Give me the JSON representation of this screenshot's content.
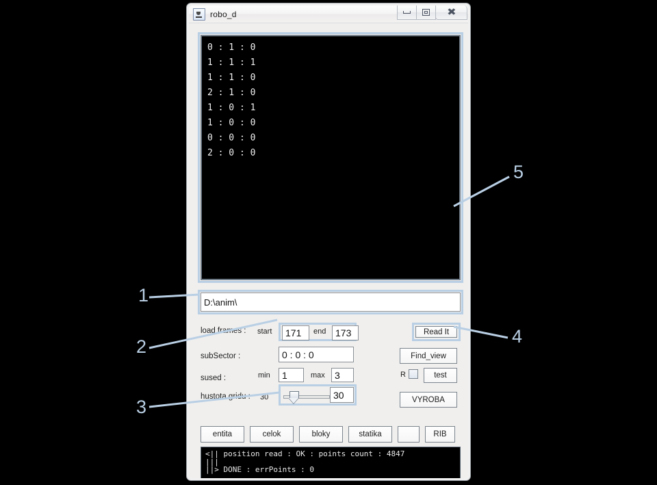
{
  "window": {
    "title": "robo_d",
    "icon": "java-coffee-cup-icon",
    "buttons": {
      "minimize": "minimize-icon",
      "maximize": "restore-icon",
      "close": "close-icon"
    }
  },
  "viewport": {
    "lines": [
      "0 : 1 : 0",
      "1 : 1 : 1",
      "1 : 1 : 0",
      "2 : 1 : 0",
      "1 : 0 : 1",
      "1 : 0 : 0",
      "0 : 0 : 0",
      "2 : 0 : 0"
    ]
  },
  "path_field": {
    "value": "D:\\anim\\",
    "placeholder": ""
  },
  "frames": {
    "label": "load frames :",
    "start_label": "start",
    "start_value": "171",
    "end_label": "end",
    "end_value": "173"
  },
  "subsector": {
    "label": "subSector :",
    "value": "0 : 0 : 0"
  },
  "sused": {
    "label": "sused :",
    "min_label": "min",
    "min_value": "1",
    "max_label": "max",
    "max_value": "3"
  },
  "grid_density": {
    "label": "hustota gridu :",
    "static_value": "30",
    "slider_value": "30",
    "slider_min": 0,
    "slider_max": 100,
    "field_value": "30"
  },
  "right_buttons": {
    "read_it": "Read It",
    "find_view": "Find_view",
    "r_label": "R",
    "r_checked": false,
    "test": "test",
    "vyroba": "VYROBA"
  },
  "bottom_buttons": [
    {
      "label": "entita"
    },
    {
      "label": "celok"
    },
    {
      "label": "bloky"
    },
    {
      "label": "statika"
    },
    {
      "label": ""
    },
    {
      "label": "RIB"
    }
  ],
  "log": {
    "lines": [
      "<|| position read : OK : points count : 4847",
      "|||",
      "||> DONE : errPoints : 0"
    ]
  },
  "callouts": [
    {
      "id": "1",
      "label": "1"
    },
    {
      "id": "2",
      "label": "2"
    },
    {
      "id": "3",
      "label": "3"
    },
    {
      "id": "4",
      "label": "4"
    },
    {
      "id": "5",
      "label": "5"
    }
  ],
  "colors": {
    "background": "#000000",
    "highlight": "#b9cfe4",
    "window_face": "#f0efee",
    "console_bg": "#000000",
    "console_text": "#f2f2f2"
  }
}
